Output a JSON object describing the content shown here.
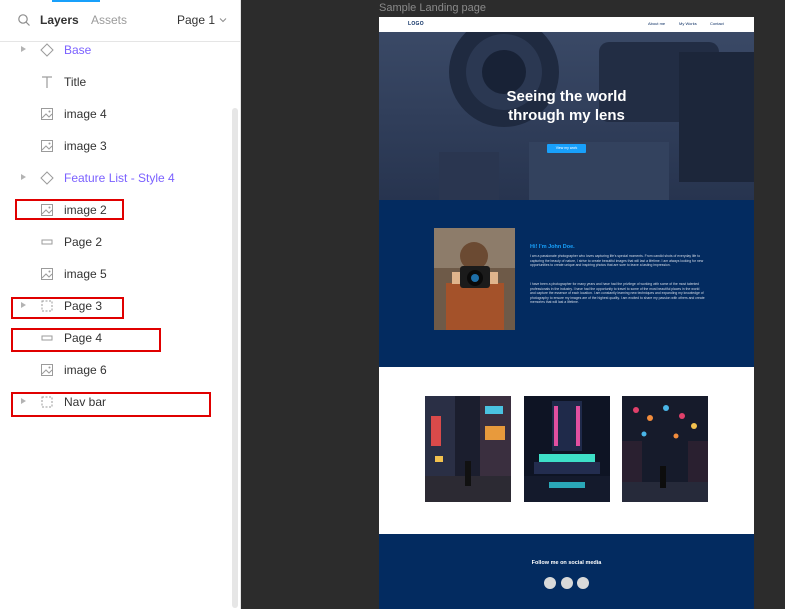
{
  "panel": {
    "tabs": {
      "layers": "Layers",
      "assets": "Assets"
    },
    "page_selector": "Page 1",
    "layers": [
      {
        "name": "Base",
        "type": "component",
        "expandable": true
      },
      {
        "name": "Title",
        "type": "text",
        "expandable": false
      },
      {
        "name": "image 4",
        "type": "image",
        "expandable": false
      },
      {
        "name": "image 3",
        "type": "image",
        "expandable": false
      },
      {
        "name": "Feature List - Style 4",
        "type": "component",
        "expandable": true
      },
      {
        "name": "image 2",
        "type": "image",
        "expandable": false,
        "highlighted": true
      },
      {
        "name": "Page 2",
        "type": "rectangle",
        "expandable": false
      },
      {
        "name": "image 5",
        "type": "image",
        "expandable": false
      },
      {
        "name": "Page 3",
        "type": "frame",
        "expandable": true,
        "highlighted": true
      },
      {
        "name": "Page 4",
        "type": "rectangle",
        "expandable": false,
        "highlighted": true
      },
      {
        "name": "image 6",
        "type": "image",
        "expandable": false
      },
      {
        "name": "Nav bar",
        "type": "frame",
        "expandable": true,
        "highlighted": true
      }
    ]
  },
  "canvas": {
    "frame_label": "Sample Landing page",
    "landing": {
      "logo": "LOGO",
      "nav_links": [
        "About me",
        "My Works",
        "Contact"
      ],
      "hero_title_line1": "Seeing the world",
      "hero_title_line2": "through my lens",
      "hero_button": "View my work",
      "about_heading": "Hi! I'm John Doe.",
      "about_para1": "I am a passionate photographer who loves capturing life's special moments. From candid shots of everyday life to capturing the beauty of nature, I strive to create beautiful images that will last a lifetime. I am always looking for new opportunities to create unique and inspiring photos that are sure to leave a lasting impression.",
      "about_para2": "I have been a photographer for many years and have had the privilege of working with some of the most talented professionals in the industry. I have had the opportunity to travel to some of the most beautiful places in the world and capture the essence of each location. I am constantly learning new techniques and expanding my knowledge of photography to ensure my images are of the highest quality. I am excited to share my passion with others and create memories that will last a lifetime.",
      "footer_text": "Follow me on social media"
    }
  },
  "colors": {
    "accent_blue": "#18a0fb",
    "component_purple": "#7b61ff",
    "navy": "#032b60",
    "highlight_red": "#e00000"
  }
}
